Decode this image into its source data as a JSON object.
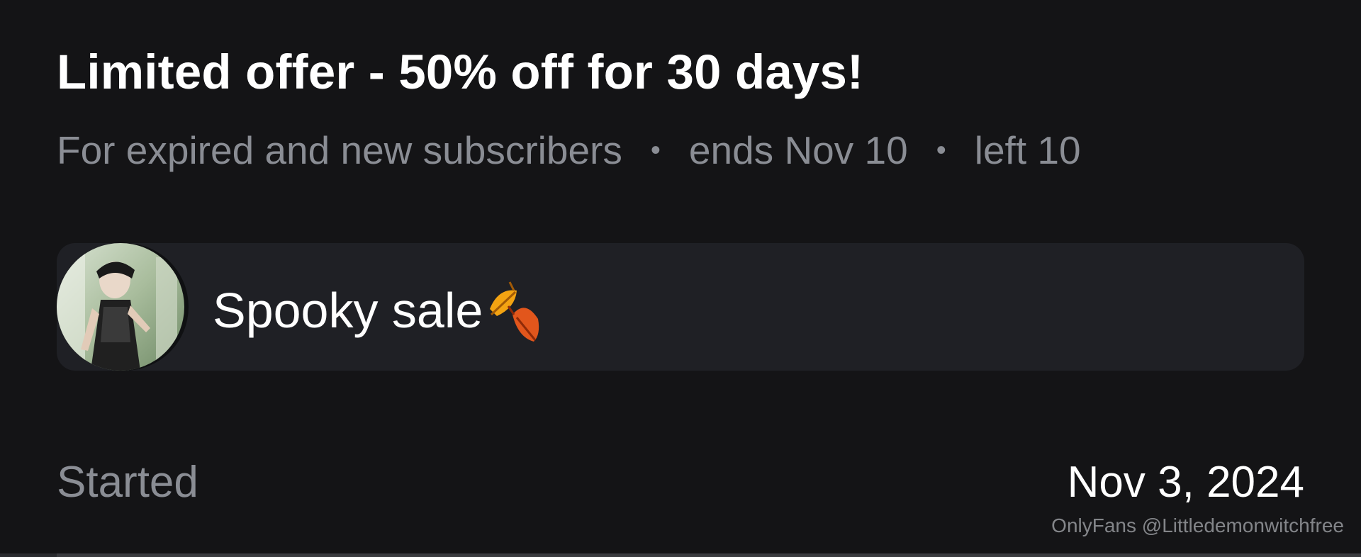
{
  "offer": {
    "title": "Limited offer - 50% off for 30 days!",
    "audience": "For expired and new subscribers",
    "separator": "•",
    "ends": "ends Nov 10",
    "left": "left 10"
  },
  "message": {
    "text": "Spooky sale",
    "emoji_icon": "fallen-leaves-icon",
    "avatar_icon": "avatar"
  },
  "details": {
    "started_label": "Started",
    "started_value": "Nov 3, 2024"
  },
  "watermark": "OnlyFans @Littledemonwitchfree",
  "colors": {
    "background": "#141416",
    "card": "#1f2025",
    "text_primary": "#ffffff",
    "text_secondary": "#8a8d94"
  }
}
